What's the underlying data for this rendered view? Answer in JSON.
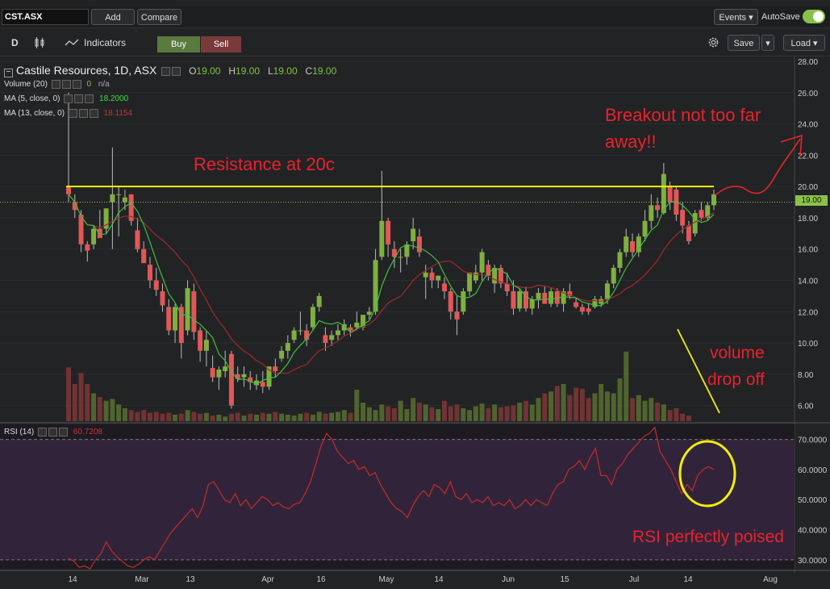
{
  "toolbar": {
    "symbol": "CST.ASX",
    "add_label": "Add",
    "compare_label": "Compare",
    "events_label": "Events ▾",
    "autosave_label": "AutoSave",
    "interval": "D",
    "indicators_label": "Indicators",
    "buy_label": "Buy",
    "sell_label": "Sell",
    "save_label": "Save",
    "load_label": "Load ▾"
  },
  "legend": {
    "title": "Castile Resources, 1D, ASX",
    "o_label": "O",
    "o_value": "19.00",
    "h_label": "H",
    "h_value": "19.00",
    "l_label": "L",
    "l_value": "19.00",
    "c_label": "C",
    "c_value": "19.00",
    "volume_label": "Volume (20)",
    "volume_value": "0",
    "volume_extra": "n/a",
    "ma5_label": "MA (5, close, 0)",
    "ma5_value": "18.2000",
    "ma13_label": "MA (13, close, 0)",
    "ma13_value": "18.1154",
    "rsi_label": "RSI (14)",
    "rsi_value": "60.7208"
  },
  "annotations": {
    "resistance": "Resistance at 20c",
    "breakout_line1": "Breakout not too far",
    "breakout_line2": "away!!",
    "volume_line1": "volume",
    "volume_line2": "drop off",
    "rsi_note": "RSI perfectly poised"
  },
  "price_tag": "19.00",
  "colors": {
    "up": "#7fb03e",
    "down": "#e25757",
    "ma5": "#3fbf3f",
    "ma13": "#a02a2a",
    "annotation": "#e8232d",
    "resistance": "#f2f000",
    "rsi_line": "#c62b2b"
  },
  "chart_data": [
    {
      "type": "candlestick",
      "title": "Castile Resources, 1D, ASX",
      "ylim": [
        5.0,
        28.0
      ],
      "y_ticks": [
        "28.00",
        "26.00",
        "24.00",
        "22.00",
        "20.00",
        "18.00",
        "16.00",
        "14.00",
        "12.00",
        "10.00",
        "8.00",
        "6.00"
      ],
      "x_ticks": [
        "14",
        "Mar",
        "13",
        "Apr",
        "16",
        "May",
        "14",
        "Jun",
        "15",
        "Jul",
        "14",
        "Aug"
      ],
      "resistance_level": 20.0,
      "candles": [
        [
          20,
          26,
          19,
          19.5
        ],
        [
          19,
          19.5,
          18,
          18.5
        ],
        [
          18.2,
          18.5,
          15.8,
          16.3
        ],
        [
          16.3,
          16.5,
          15.2,
          15.9
        ],
        [
          16.3,
          17.5,
          16,
          17.3
        ],
        [
          17.3,
          18.5,
          16.8,
          16.7
        ],
        [
          17.3,
          18.6,
          17,
          18.6
        ],
        [
          19,
          22.5,
          16,
          19.5
        ],
        [
          19.5,
          20,
          16.8,
          19.5
        ],
        [
          19,
          19.8,
          18.5,
          19.3
        ],
        [
          19.5,
          19.5,
          17.5,
          17.8
        ],
        [
          17.2,
          18,
          15.8,
          16
        ],
        [
          16,
          16.5,
          15.5,
          15.1
        ],
        [
          15,
          15.5,
          13.5,
          14
        ],
        [
          14,
          14.8,
          13,
          13.4
        ],
        [
          13.3,
          13.8,
          12,
          12.4
        ],
        [
          12.3,
          12.8,
          10.5,
          10.8
        ],
        [
          10.8,
          12.5,
          10,
          12.3
        ],
        [
          12.3,
          12.5,
          9,
          10
        ],
        [
          10.8,
          14,
          10.5,
          13.5
        ],
        [
          13.3,
          13.8,
          10.2,
          10.7
        ],
        [
          10.8,
          11,
          8.8,
          9.5
        ],
        [
          9.5,
          10.8,
          8.5,
          10.2
        ],
        [
          8.4,
          9.2,
          7.5,
          7.8
        ],
        [
          7.8,
          8.5,
          7,
          8.3
        ],
        [
          8.2,
          9.5,
          7.8,
          8.5
        ],
        [
          9.3,
          9.5,
          5.8,
          6
        ],
        [
          8,
          8.5,
          7.5,
          7.7
        ],
        [
          7.8,
          8.5,
          7.2,
          8
        ],
        [
          7.8,
          8.2,
          7,
          7.5
        ],
        [
          7.3,
          8,
          7,
          7.6
        ],
        [
          7.5,
          8.2,
          6.8,
          7.2
        ],
        [
          7.2,
          8.5,
          7,
          8.5
        ],
        [
          8.5,
          9,
          7.8,
          8.2
        ],
        [
          9,
          9.8,
          8.8,
          9.5
        ],
        [
          9.5,
          10.5,
          9,
          10
        ],
        [
          10.2,
          11,
          10,
          10.8
        ],
        [
          10.8,
          12,
          10.5,
          10.8
        ],
        [
          10.8,
          11.2,
          9.8,
          10.2
        ],
        [
          11,
          12.5,
          10.8,
          12.3
        ],
        [
          12.3,
          13.2,
          12,
          13
        ],
        [
          10.5,
          11,
          9.5,
          10
        ],
        [
          10.2,
          10.8,
          9.8,
          10.5
        ],
        [
          10.5,
          11.2,
          10.2,
          10.8
        ],
        [
          10.8,
          11.5,
          10.5,
          11.2
        ],
        [
          11,
          11.2,
          10.4,
          10.8
        ],
        [
          11,
          12,
          10.8,
          11.3
        ],
        [
          11,
          11.8,
          10.8,
          11.8
        ],
        [
          11.8,
          12.3,
          11.5,
          12
        ],
        [
          12,
          16,
          11.8,
          15.3
        ],
        [
          15.5,
          21,
          15.3,
          17.8
        ],
        [
          17.8,
          18,
          15.5,
          16.3
        ],
        [
          16,
          16.5,
          14.8,
          15.5
        ],
        [
          15.5,
          16,
          14.5,
          15.5
        ],
        [
          15.5,
          16.5,
          15,
          16.3
        ],
        [
          16.5,
          18,
          16,
          17.3
        ],
        [
          16.8,
          17.3,
          15.5,
          15.8
        ],
        [
          14.2,
          15,
          12.8,
          14.5
        ],
        [
          14.5,
          14.8,
          13.5,
          14.0
        ],
        [
          14.0,
          14.3,
          13.5,
          14.3
        ],
        [
          13.8,
          14.2,
          12.8,
          13.3
        ],
        [
          13.3,
          13.5,
          11.5,
          12.0
        ],
        [
          12.0,
          13.0,
          10.5,
          11.5
        ],
        [
          12.0,
          13.5,
          11.8,
          13.3
        ],
        [
          13.3,
          14.5,
          13.0,
          14.5
        ],
        [
          14.0,
          15.0,
          13.8,
          14.5
        ],
        [
          14.5,
          16.0,
          14.0,
          15.8
        ],
        [
          15.0,
          15.3,
          14.0,
          14.3
        ],
        [
          13.8,
          15.0,
          13.2,
          14.8
        ],
        [
          14.8,
          15.0,
          13.5,
          13.8
        ],
        [
          13.8,
          14.5,
          13.0,
          13.3
        ],
        [
          13.3,
          14.0,
          11.8,
          12.2
        ],
        [
          12.2,
          13.5,
          12.0,
          13.3
        ],
        [
          13.3,
          13.6,
          12.0,
          12.2
        ],
        [
          12.2,
          13.0,
          11.8,
          12.8
        ],
        [
          12.8,
          13.5,
          12.2,
          13.2
        ],
        [
          13.2,
          13.6,
          12.5,
          12.5
        ],
        [
          12.5,
          13.5,
          12.3,
          13.3
        ],
        [
          13.3,
          13.5,
          12.3,
          12.5
        ],
        [
          12.5,
          13.5,
          12.0,
          13.3
        ],
        [
          13.3,
          13.8,
          12.8,
          13.0
        ],
        [
          12.6,
          12.9,
          12.2,
          12.3
        ],
        [
          12.3,
          12.5,
          11.8,
          12.0
        ],
        [
          12.2,
          12.5,
          11.8,
          12.0
        ],
        [
          12.3,
          13.0,
          12.2,
          12.8
        ],
        [
          12.5,
          13.0,
          12.3,
          12.8
        ],
        [
          12.8,
          14.0,
          12.5,
          13.8
        ],
        [
          13.8,
          15.0,
          13.5,
          14.8
        ],
        [
          14.8,
          16.0,
          14.5,
          15.8
        ],
        [
          15.8,
          17.3,
          15.5,
          16.8
        ],
        [
          16.5,
          17.0,
          15.5,
          15.8
        ],
        [
          15.8,
          17.0,
          15.5,
          16.8
        ],
        [
          16.8,
          18.5,
          16.5,
          17.8
        ],
        [
          17.8,
          19.5,
          17.3,
          18.8
        ],
        [
          18.8,
          19.3,
          18.0,
          18.5
        ],
        [
          18.3,
          21.5,
          18.2,
          20.8
        ],
        [
          20.0,
          20.3,
          18.5,
          19.0
        ],
        [
          19.8,
          20.0,
          17.8,
          18.2
        ],
        [
          18.5,
          19.0,
          17.0,
          17.5
        ],
        [
          17.5,
          17.8,
          16.3,
          16.5
        ],
        [
          17.0,
          18.5,
          16.8,
          18.3
        ],
        [
          18.5,
          19.0,
          17.8,
          18.0
        ],
        [
          18.0,
          19.0,
          17.8,
          18.8
        ],
        [
          18.8,
          19.8,
          18.5,
          19.5
        ]
      ],
      "volume_scale_ylim": [
        0,
        100
      ],
      "volume": [
        58,
        40,
        52,
        40,
        30,
        26,
        22,
        24,
        18,
        14,
        12,
        10,
        12,
        9,
        10,
        8,
        9,
        7,
        8,
        12,
        10,
        8,
        9,
        6,
        7,
        5,
        8,
        9,
        6,
        8,
        7,
        9,
        8,
        10,
        8,
        7,
        6,
        8,
        9,
        7,
        10,
        8,
        9,
        10,
        12,
        9,
        34,
        20,
        15,
        12,
        18,
        16,
        14,
        22,
        13,
        25,
        20,
        18,
        15,
        13,
        22,
        16,
        18,
        14,
        12,
        16,
        19,
        14,
        18,
        15,
        16,
        17,
        20,
        22,
        18,
        25,
        30,
        32,
        38,
        40,
        28,
        36,
        35,
        25,
        30,
        40,
        32,
        30,
        46,
        75,
        25,
        28,
        22,
        25,
        20,
        18,
        12,
        14,
        8,
        6
      ]
    },
    {
      "type": "line",
      "title": "RSI (14)",
      "ylim": [
        27,
        75
      ],
      "y_ticks": [
        "70.0000",
        "60.0000",
        "50.0000",
        "40.0000",
        "30.0000"
      ],
      "bands": [
        70,
        30
      ],
      "values": [
        30.5,
        29.5,
        27.5,
        28,
        27,
        30,
        32,
        36,
        33,
        31,
        29.5,
        28,
        27.5,
        28.5,
        30,
        31,
        30,
        33,
        36,
        39,
        41,
        43,
        45,
        47,
        44,
        48,
        55,
        56,
        53,
        50,
        49,
        52,
        48,
        50,
        47,
        49,
        51,
        50,
        48,
        49,
        47.5,
        47,
        48.5,
        49,
        52,
        56,
        62,
        68,
        72,
        70,
        66,
        64,
        62,
        63,
        60,
        61,
        58,
        59,
        55,
        52,
        49,
        47,
        46,
        44,
        48,
        51,
        53,
        51,
        55,
        54,
        52,
        56,
        51,
        50,
        52,
        49,
        50,
        49,
        51,
        48,
        49,
        48,
        50,
        47,
        48,
        50,
        48,
        50,
        49,
        48,
        52,
        55,
        56,
        60,
        61,
        63,
        60,
        64,
        67,
        58,
        58,
        55,
        60,
        62,
        65,
        67,
        69,
        71,
        72,
        74,
        66,
        63,
        60,
        56,
        52,
        55,
        53,
        58,
        60,
        61,
        60
      ]
    }
  ]
}
